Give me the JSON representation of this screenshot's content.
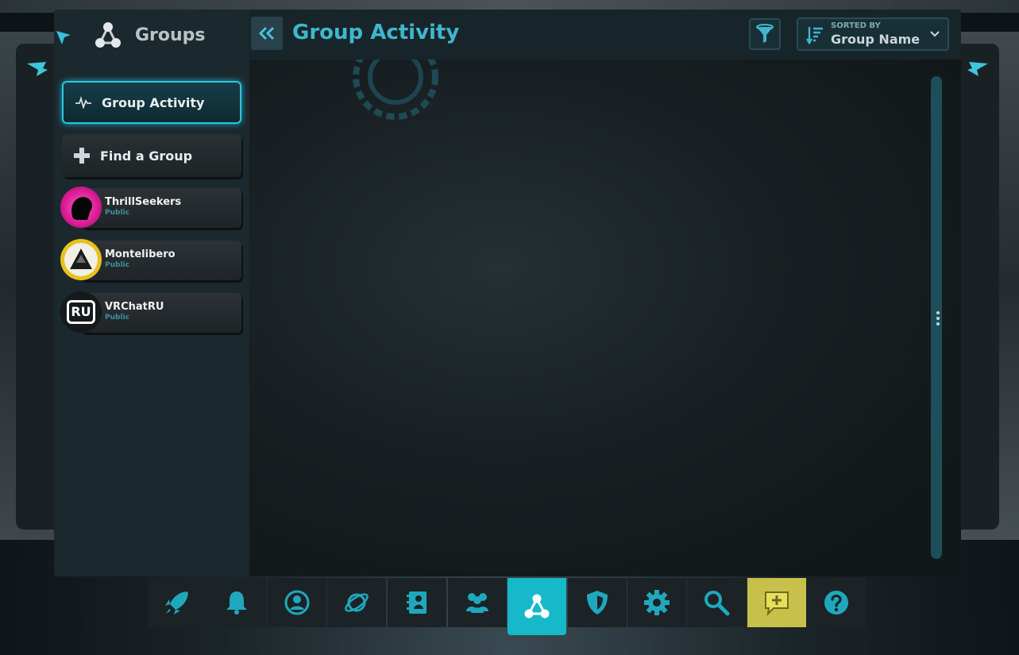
{
  "sidebar": {
    "title": "Groups",
    "nav": [
      {
        "label": "Group Activity",
        "icon": "activity-icon",
        "active": true
      },
      {
        "label": "Find a Group",
        "icon": "plus-icon",
        "active": false
      }
    ],
    "groups": [
      {
        "name": "ThrillSeekers",
        "privacy": "Public",
        "avatar_icon": "thrillseekers-avatar"
      },
      {
        "name": "Montelibero",
        "privacy": "Public",
        "avatar_icon": "montelibero-avatar"
      },
      {
        "name": "VRChatRU",
        "privacy": "Public",
        "avatar_icon": "vrchatru-avatar",
        "avatar_text": "RU"
      }
    ]
  },
  "header": {
    "title": "Group Activity",
    "sort_caption": "SORTED BY",
    "sort_value": "Group Name"
  },
  "dock": {
    "items": [
      {
        "icon": "rocket-icon"
      },
      {
        "icon": "bell-icon"
      },
      {
        "icon": "profile-icon"
      },
      {
        "icon": "planet-icon"
      },
      {
        "icon": "avatar-book-icon"
      },
      {
        "icon": "friends-icon"
      },
      {
        "icon": "groups-icon",
        "active": true
      },
      {
        "icon": "shield-icon"
      },
      {
        "icon": "settings-gear-icon"
      },
      {
        "icon": "search-icon"
      },
      {
        "icon": "add-chat-icon"
      },
      {
        "icon": "help-icon"
      }
    ]
  },
  "colors": {
    "accent": "#3fb7cd",
    "active_dock": "#16b8c9",
    "chat_button": "#c7c04a"
  }
}
